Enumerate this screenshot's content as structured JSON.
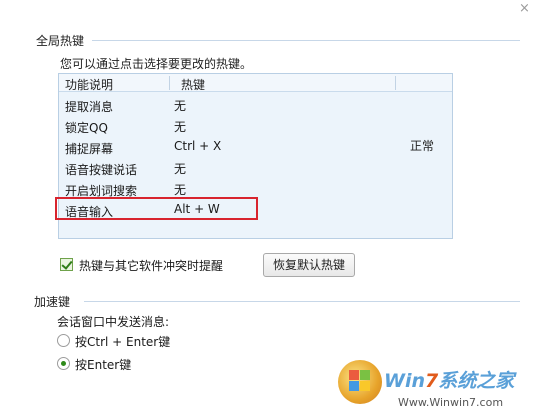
{
  "window": {
    "close_glyph": "×"
  },
  "global_hotkeys": {
    "title": "全局热键",
    "hint": "您可以通过点击选择要更改的热键。",
    "columns": [
      "功能说明",
      "热键"
    ],
    "rows": [
      {
        "function": "提取消息",
        "hotkey": "无"
      },
      {
        "function": "锁定QQ",
        "hotkey": "无"
      },
      {
        "function": "捕捉屏幕",
        "hotkey": "Ctrl + X"
      },
      {
        "function": "语音按键说话",
        "hotkey": "无"
      },
      {
        "function": "开启划词搜索",
        "hotkey": "无"
      },
      {
        "function": "语音输入",
        "hotkey": "Alt + W"
      }
    ],
    "status": "正常",
    "highlighted_row_index": 5,
    "conflict_checkbox": {
      "label": "热键与其它软件冲突时提醒",
      "checked": true
    },
    "restore_button": "恢复默认热键"
  },
  "accelerator": {
    "title": "加速键",
    "send_label": "会话窗口中发送消息:",
    "options": [
      {
        "label": "按Ctrl + Enter键",
        "selected": false
      },
      {
        "label": "按Enter键",
        "selected": true
      }
    ]
  },
  "watermark": {
    "title_prefix": "Win",
    "title_digit": "7",
    "title_suffix": "系统之家",
    "url": "Www.Winwin7.com"
  },
  "colors": {
    "highlight_border": "#d8242e",
    "table_background": "#ecf4fb",
    "checkbox_green": "#2e7d16"
  }
}
